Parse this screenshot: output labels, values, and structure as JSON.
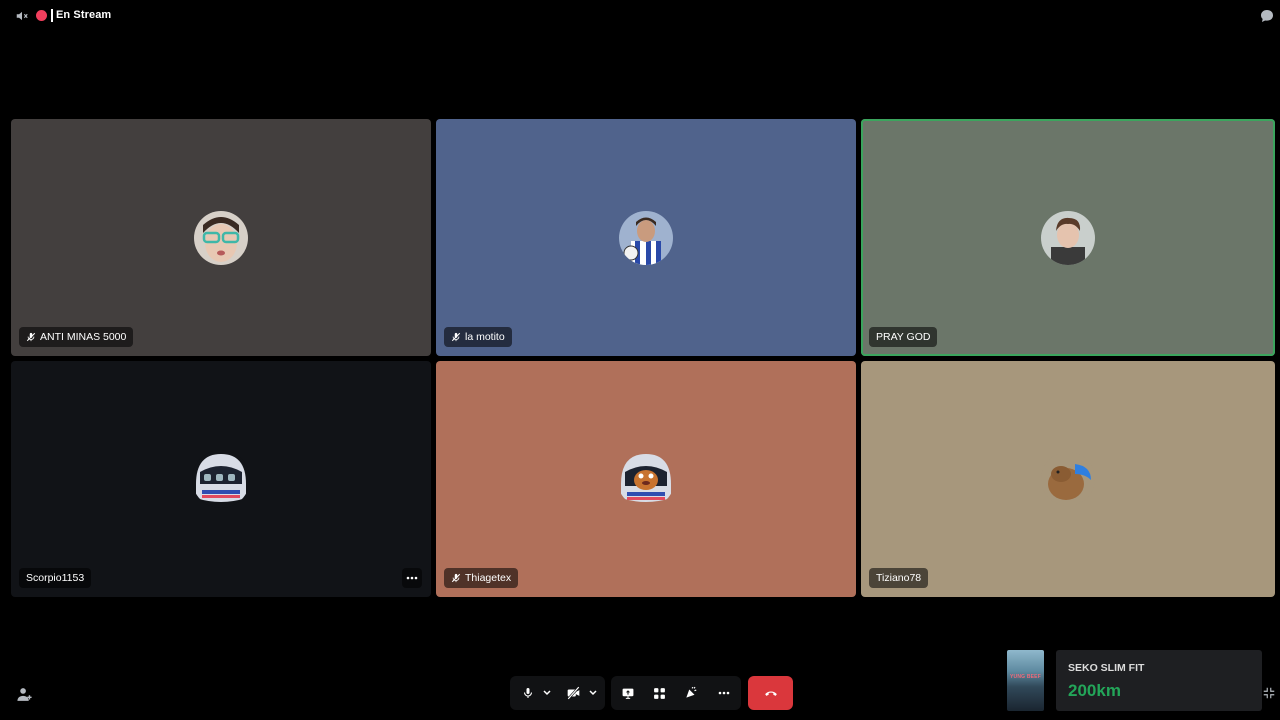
{
  "topbar": {
    "title": "En Stream",
    "live_color": "#f23f5d"
  },
  "tiles": [
    {
      "name": "ANTI MINAS 5000",
      "muted": true,
      "bg": "#433f3e",
      "avatar": "boy-glasses-avatar"
    },
    {
      "name": "la motito",
      "muted": true,
      "bg": "#50638c",
      "avatar": "footballer-avatar"
    },
    {
      "name": "PRAY GOD",
      "muted": false,
      "speaking": true,
      "bg": "#6b7669",
      "avatar": "young-man-avatar"
    },
    {
      "name": "Scorpio1153",
      "muted": false,
      "bg": "#111317",
      "avatar": "helmet-avatar",
      "has_more": true
    },
    {
      "name": "Thiagetex",
      "muted": true,
      "bg": "#b0705a",
      "avatar": "helmet-character-avatar"
    },
    {
      "name": "Tiziano78",
      "muted": false,
      "bg": "#a7977c",
      "avatar": "capybara-avatar"
    }
  ],
  "controls": {
    "buttons": [
      "microphone",
      "camera-off",
      "screen-share",
      "activities",
      "soundboard",
      "more"
    ],
    "hangup_color": "#da373c"
  },
  "now_playing": {
    "cover_text": "YUNG BEEF",
    "song": "SEKO SLIM FIT",
    "distance": "200km"
  },
  "colors": {
    "background": "#000000",
    "speaking_ring": "#3ba55d",
    "distance": "#23a559"
  }
}
